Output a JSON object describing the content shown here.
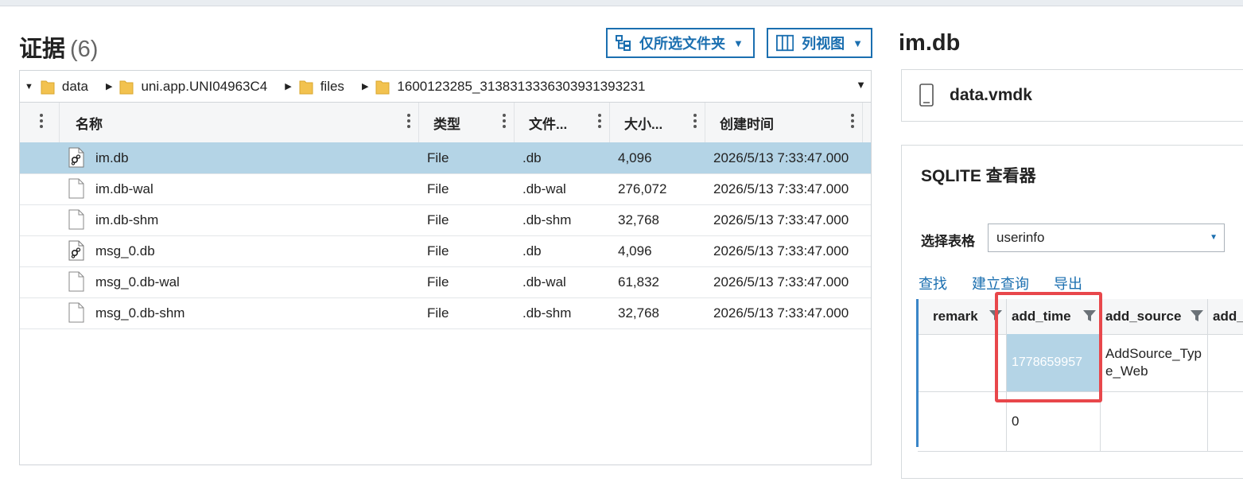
{
  "evidence": {
    "title": "证据",
    "count": "(6)"
  },
  "toolbar": {
    "folder_filter_label": "仅所选文件夹",
    "view_label": "列视图"
  },
  "path": [
    "data",
    "uni.app.UNI04963C4",
    "files",
    "1600123285_3138313336303931393231"
  ],
  "columns": {
    "name": "名称",
    "type": "类型",
    "ext": "文件...",
    "size": "大小...",
    "created": "创建时间"
  },
  "files": [
    {
      "name": "im.db",
      "type": "File",
      "ext": ".db",
      "size": "4,096",
      "created": "2026/5/13 7:33:47.000",
      "icon": "database-file-icon"
    },
    {
      "name": "im.db-wal",
      "type": "File",
      "ext": ".db-wal",
      "size": "276,072",
      "created": "2026/5/13 7:33:47.000",
      "icon": "file-icon"
    },
    {
      "name": "im.db-shm",
      "type": "File",
      "ext": ".db-shm",
      "size": "32,768",
      "created": "2026/5/13 7:33:47.000",
      "icon": "file-icon"
    },
    {
      "name": "msg_0.db",
      "type": "File",
      "ext": ".db",
      "size": "4,096",
      "created": "2026/5/13 7:33:47.000",
      "icon": "database-file-icon"
    },
    {
      "name": "msg_0.db-wal",
      "type": "File",
      "ext": ".db-wal",
      "size": "61,832",
      "created": "2026/5/13 7:33:47.000",
      "icon": "file-icon"
    },
    {
      "name": "msg_0.db-shm",
      "type": "File",
      "ext": ".db-shm",
      "size": "32,768",
      "created": "2026/5/13 7:33:47.000",
      "icon": "file-icon"
    }
  ],
  "detail": {
    "title": "im.db",
    "source": "data.vmdk",
    "viewer_title": "SQLITE 查看器",
    "table_label": "选择表格",
    "table_selected": "userinfo",
    "links": [
      "查找",
      "建立查询",
      "导出"
    ],
    "sql_columns": [
      "remark",
      "add_time",
      "add_source",
      "add_"
    ],
    "sql_rows": [
      {
        "remark": "",
        "add_time": "1778659957",
        "add_source": "AddSource_Type_Web"
      },
      {
        "remark": "",
        "add_time": "0",
        "add_source": ""
      }
    ]
  },
  "colors": {
    "accent": "#1b6fb0",
    "selected_row": "#b4d4e6",
    "highlight": "#e8474b"
  }
}
